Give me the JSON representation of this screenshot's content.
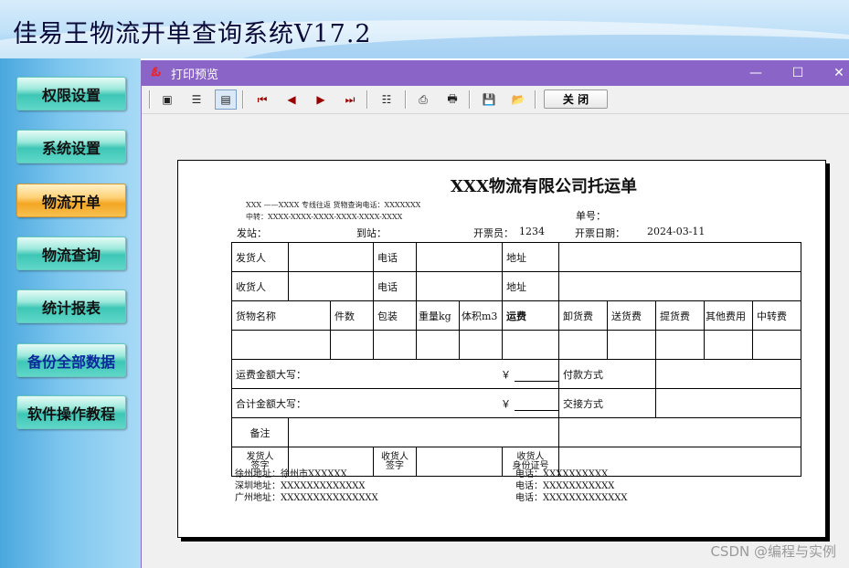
{
  "app": {
    "title": "佳易王物流开单查询系统V17.2"
  },
  "sidebar": {
    "items": [
      {
        "label": "权限设置"
      },
      {
        "label": "系统设置"
      },
      {
        "label": "物流开单"
      },
      {
        "label": "物流查询"
      },
      {
        "label": "统计报表"
      },
      {
        "label": "备份全部数据"
      },
      {
        "label": "软件操作教程"
      }
    ]
  },
  "window": {
    "title": "打印预览",
    "minimize": "—",
    "maximize": "☐",
    "close": "✕"
  },
  "toolbar": {
    "close_label": "关 闭"
  },
  "doc": {
    "title": "XXX物流有限公司托运单",
    "line1": "XXX ——XXXX 专线往返 货物查询电话：XXXXXXX",
    "line2": "中转：XXXX-XXXX-XXXX-XXXX-XXXX-XXXX",
    "order_no_label": "单号：",
    "origin_label": "发站：",
    "dest_label": "到站：",
    "issuer_label": "开票员：",
    "issuer_value": "1234",
    "date_label": "开票日期：",
    "date_value": "2024-03-11",
    "row_shipper": "发货人",
    "row_phone": "电话",
    "row_address": "地址",
    "row_consignee": "收货人",
    "headers": [
      "货物名称",
      "件数",
      "包装",
      "重量kg",
      "体积m3",
      "运费",
      "卸货费",
      "送货费",
      "提货费",
      "其他费用",
      "中转费"
    ],
    "freight_words_label": "运费金额大写：",
    "yen": "￥",
    "payment_label": "付款方式",
    "total_words_label": "合计金额大写：",
    "delivery_label": "交接方式",
    "remark_label": "备注",
    "shipper_sign": "发货人\n签字",
    "consignee_sign": "收货人\n签字",
    "consignee_id": "收货人\n身份证号",
    "addresses": [
      {
        "label": "徐州地址：",
        "value": "徐州市XXXXXX",
        "phone_label": "电话：",
        "phone": "XXXXXXXXXX"
      },
      {
        "label": "深圳地址：",
        "value": "XXXXXXXXXXXXX",
        "phone_label": "电话：",
        "phone": "XXXXXXXXXXX"
      },
      {
        "label": "广州地址：",
        "value": "XXXXXXXXXXXXXXX",
        "phone_label": "电话：",
        "phone": "XXXXXXXXXXXXX"
      }
    ]
  },
  "watermark": "CSDN @编程与实例"
}
